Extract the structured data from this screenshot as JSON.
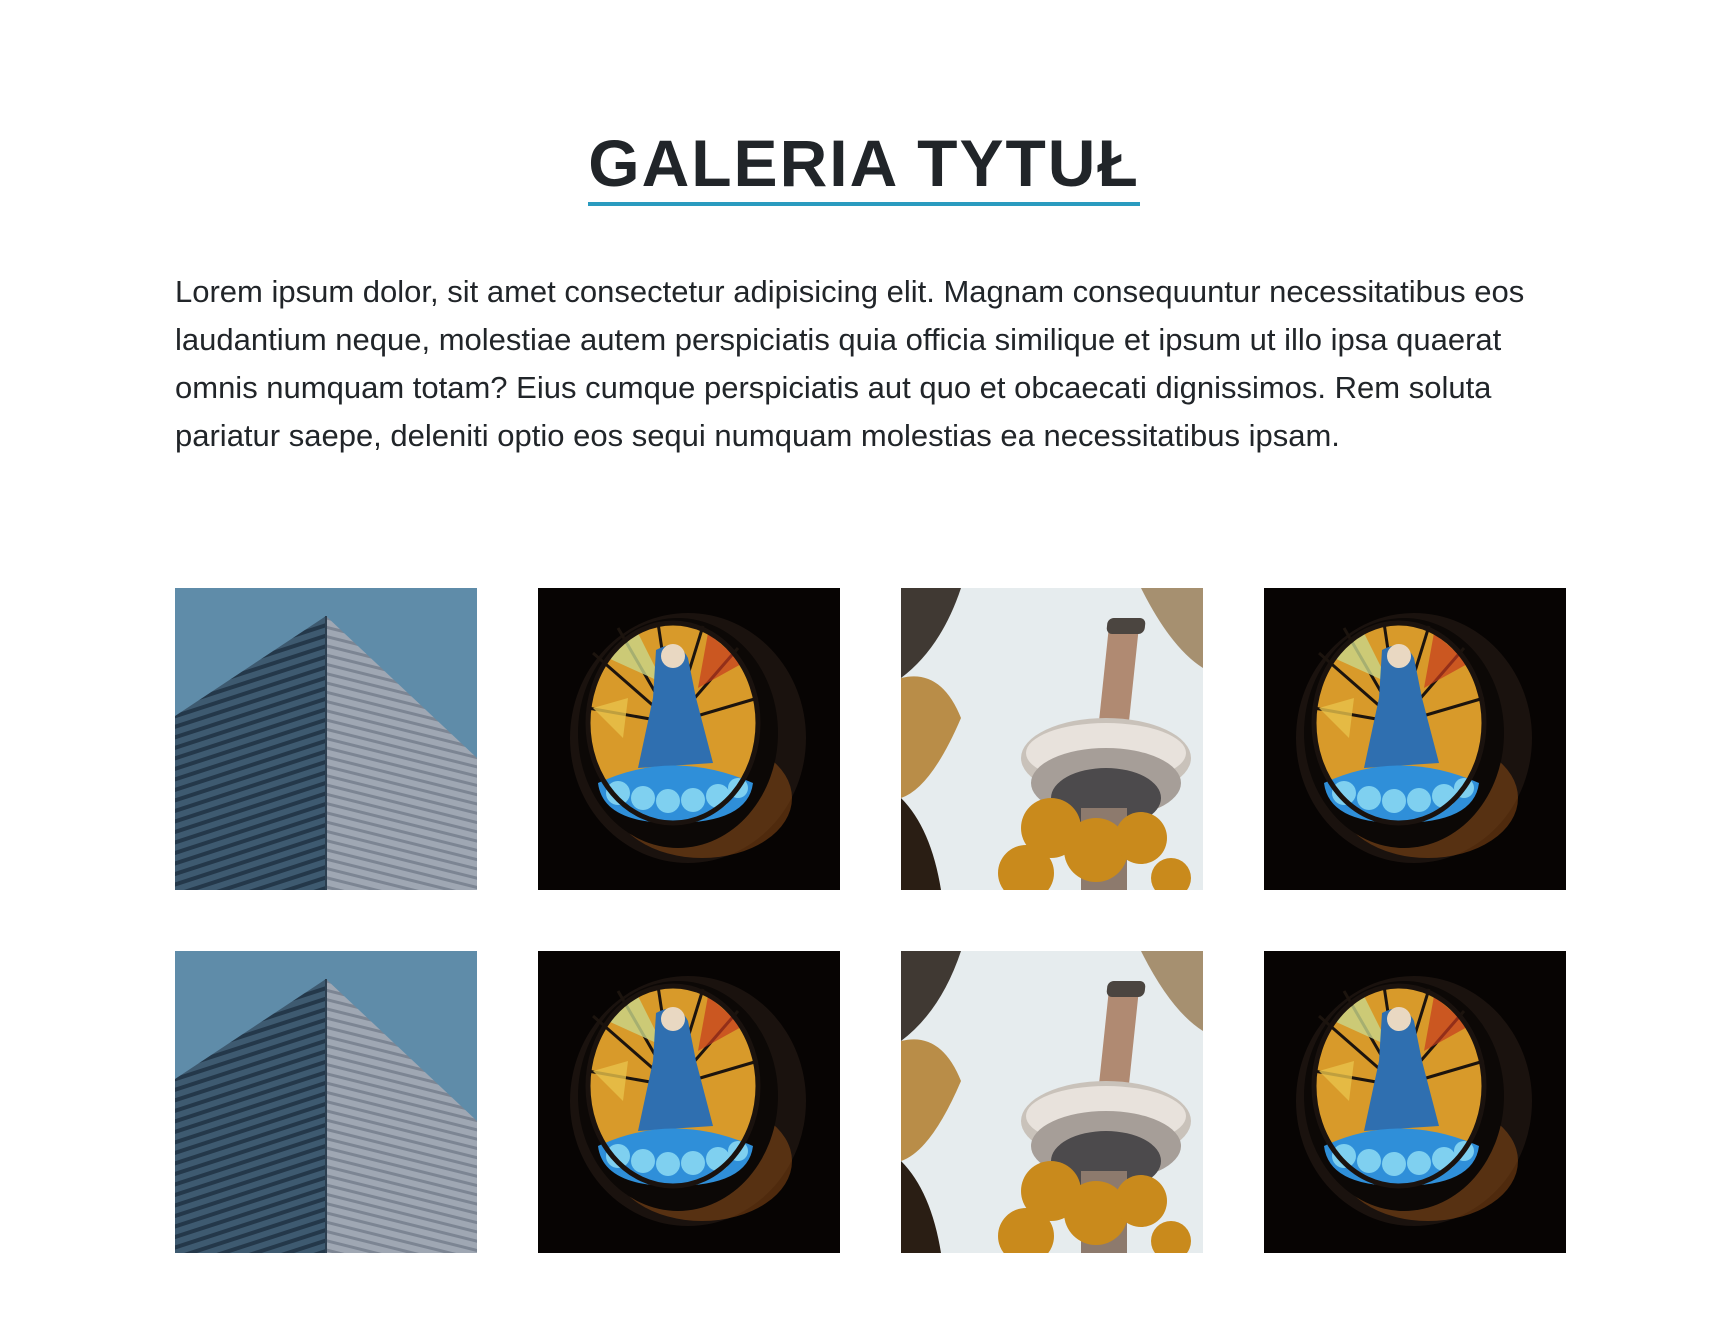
{
  "header": {
    "title": "GALERIA TYTUŁ",
    "accent_color": "#2a9bbf"
  },
  "intro": {
    "text": "Lorem ipsum dolor, sit amet consectetur adipisicing elit. Magnam consequuntur necessitatibus eos laudantium neque, molestiae autem perspiciatis quia officia similique et ipsum ut illo ipsa quaerat omnis numquam totam? Eius cumque perspiciatis aut quo et obcaecati dignissimos. Rem soluta pariatur saepe, deleniti optio eos sequi numquam molestias ea necessitatibus ipsam."
  },
  "gallery": {
    "images": [
      {
        "subject": "building-corner"
      },
      {
        "subject": "stained-glass-window"
      },
      {
        "subject": "tv-tower"
      },
      {
        "subject": "stained-glass-window"
      },
      {
        "subject": "building-corner"
      },
      {
        "subject": "stained-glass-window"
      },
      {
        "subject": "tv-tower"
      },
      {
        "subject": "stained-glass-window"
      }
    ]
  }
}
